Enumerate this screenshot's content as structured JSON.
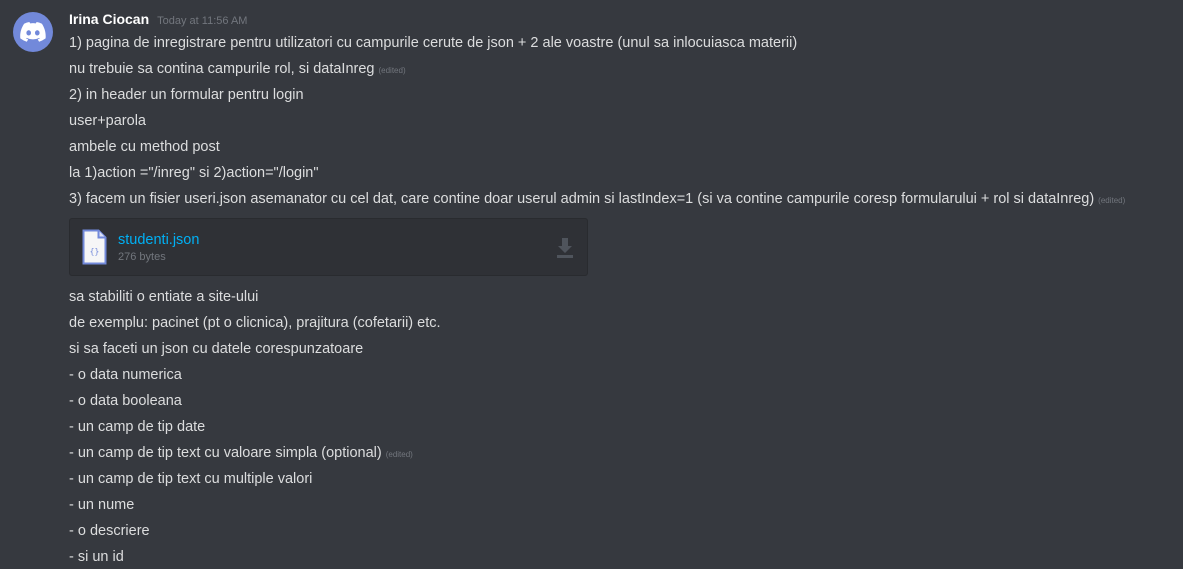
{
  "message": {
    "author": "Irina Ciocan",
    "timestamp": "Today at 11:56 AM",
    "edited_label": "(edited)",
    "lines_before": [
      "1) pagina de inregistrare pentru utilizatori cu campurile cerute de json + 2 ale voastre (unul sa inlocuiasca materii)",
      "nu trebuie sa contina campurile rol, si dataInreg",
      "2) in header un formular pentru login",
      "user+parola",
      "ambele cu method post",
      "la 1)action =\"/inreg\"  si 2)action=\"/login\"",
      "3) facem un fisier useri.json asemanator cu cel dat, care contine doar userul admin si lastIndex=1 (si va contine campurile coresp formularului + rol si dataInreg)"
    ],
    "attachment": {
      "filename": "studenti.json",
      "size": "276 bytes",
      "icon": "json-file-icon",
      "download_icon": "download-icon"
    },
    "lines_after": [
      "sa stabiliti o entiate a site-ului",
      "de exemplu: pacinet (pt o clicnica), prajitura (cofetarii) etc.",
      "si sa faceti un json cu datele corespunzatoare",
      "- o data numerica",
      "- o data booleana",
      "- un camp de tip date",
      "- un camp de tip text cu valoare simpla (optional)",
      "- un camp de tip text cu multiple valori",
      "- un nume",
      "- o descriere",
      "- si un id"
    ]
  },
  "colors": {
    "background": "#36393f",
    "text": "#dcddde",
    "muted": "#72767d",
    "link": "#00b0f4",
    "avatar": "#7289da"
  }
}
